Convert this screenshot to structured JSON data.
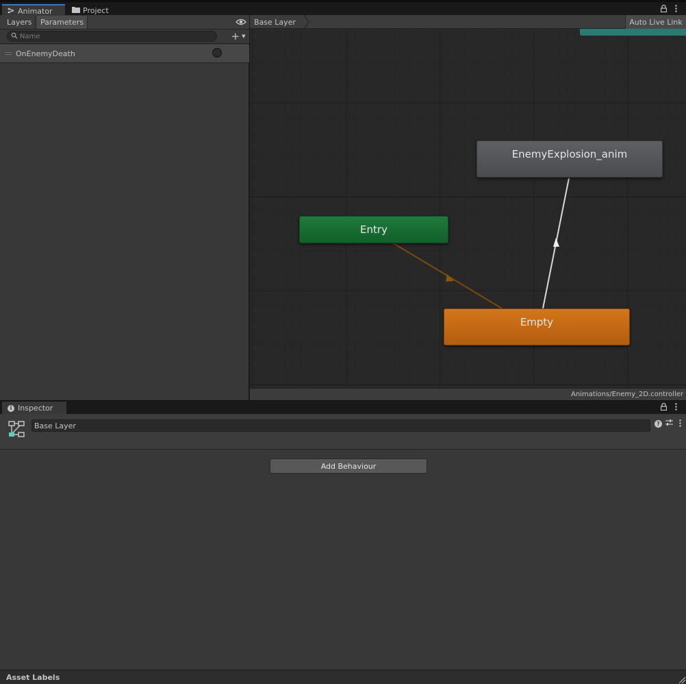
{
  "window_tabs": {
    "animator": "Animator",
    "project": "Project"
  },
  "left_panel": {
    "tabs": [
      "Layers",
      "Parameters"
    ],
    "search_placeholder": "Name",
    "add_symbol": "+",
    "parameters": [
      {
        "name": "OnEnemyDeath",
        "type": "trigger"
      }
    ]
  },
  "graph": {
    "breadcrumb": "Base Layer",
    "auto_live_link": "Auto Live Link",
    "nodes": {
      "entry": "Entry",
      "explosion": "EnemyExplosion_anim",
      "empty": "Empty"
    },
    "controller_path": "Animations/Enemy_2D.controller"
  },
  "inspector": {
    "tab_label": "Inspector",
    "layer_name": "Base Layer",
    "add_behaviour_label": "Add Behaviour",
    "asset_labels_title": "Asset Labels"
  },
  "colors": {
    "entry_node": "#1f7a3b",
    "default_state_node": "#d4761a",
    "state_node": "#5d5f63",
    "any_state_node": "#2a7a74",
    "selection_accent": "#3a79bb"
  },
  "icons": [
    "animator-icon",
    "folder-icon",
    "lock-icon",
    "menu-icon",
    "eye-icon",
    "search-icon",
    "add-icon",
    "info-icon",
    "layer-icon",
    "help-icon",
    "preset-icon"
  ]
}
